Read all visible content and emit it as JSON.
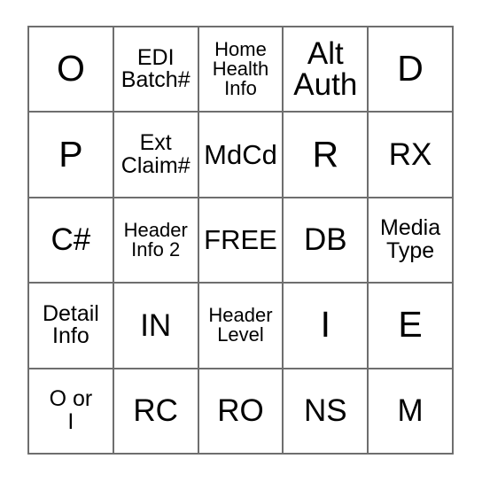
{
  "card": {
    "kind": "bingo-card",
    "columns": 5,
    "rows": 5,
    "colors": {
      "page_background": "#ffffff",
      "cell_background": "#ffffff",
      "grid_line": "#6e6e6e",
      "text": "#000000"
    },
    "cells": [
      [
        {
          "label": "O",
          "size": "xl",
          "lines": 1
        },
        {
          "label": "EDI\nBatch#",
          "size": "sm",
          "lines": 2
        },
        {
          "label": "Home\nHealth\nInfo",
          "size": "xs",
          "lines": 3
        },
        {
          "label": "Alt\nAuth",
          "size": "lg",
          "lines": 2
        },
        {
          "label": "D",
          "size": "xl",
          "lines": 1
        }
      ],
      [
        {
          "label": "P",
          "size": "xl",
          "lines": 1
        },
        {
          "label": "Ext\nClaim#",
          "size": "sm",
          "lines": 2
        },
        {
          "label": "MdCd",
          "size": "md",
          "lines": 1
        },
        {
          "label": "R",
          "size": "xl",
          "lines": 1
        },
        {
          "label": "RX",
          "size": "lg",
          "lines": 1
        }
      ],
      [
        {
          "label": "C#",
          "size": "lg",
          "lines": 1
        },
        {
          "label": "Header\nInfo 2",
          "size": "xs",
          "lines": 2
        },
        {
          "label": "FREE",
          "size": "md",
          "lines": 1
        },
        {
          "label": "DB",
          "size": "lg",
          "lines": 1
        },
        {
          "label": "Media\nType",
          "size": "sm",
          "lines": 2
        }
      ],
      [
        {
          "label": "Detail\nInfo",
          "size": "sm",
          "lines": 2
        },
        {
          "label": "IN",
          "size": "lg",
          "lines": 1
        },
        {
          "label": "Header\nLevel",
          "size": "xs",
          "lines": 2
        },
        {
          "label": "I",
          "size": "xl",
          "lines": 1
        },
        {
          "label": "E",
          "size": "xl",
          "lines": 1
        }
      ],
      [
        {
          "label": "O or\nI",
          "size": "sm",
          "lines": 2
        },
        {
          "label": "RC",
          "size": "lg",
          "lines": 1
        },
        {
          "label": "RO",
          "size": "lg",
          "lines": 1
        },
        {
          "label": "NS",
          "size": "lg",
          "lines": 1
        },
        {
          "label": "M",
          "size": "lg",
          "lines": 1
        }
      ]
    ]
  }
}
